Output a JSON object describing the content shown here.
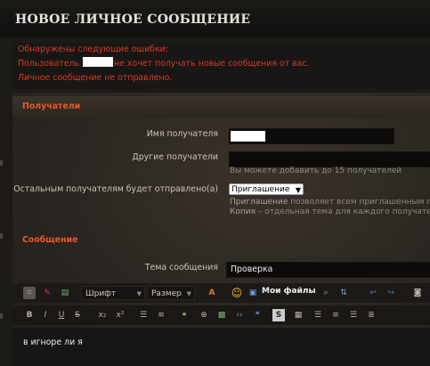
{
  "header": {
    "title": "НОВОЕ ЛИЧНОЕ СООБЩЕНИЕ"
  },
  "errors": {
    "line1": "Обнаружены следующие ошибки:",
    "line2_prefix": "Пользователь",
    "line2_suffix": "не хочет получать новые сообщения от вас.",
    "line3": "Личное сообщение не отправлено."
  },
  "recipients": {
    "heading": "Получатели",
    "recipient_name_label": "Имя получателя",
    "other_recipients_label": "Другие получатели",
    "other_recipients_hint": "Вы можете добавить до 15 получателей",
    "send_mode_label": "Остальным получателям будет отправлено(a)",
    "send_mode_value": "Приглашение",
    "hint_invite_term": "Приглашение",
    "hint_invite_text": "позволяет всем приглашенным п",
    "hint_copy_term": "Копия",
    "hint_copy_text": "– отдельная тема для каждого получате"
  },
  "message": {
    "heading": "Сообщение",
    "subject_label": "Тема сообщения",
    "subject_value": "Проверка",
    "body_text": "в игноре ли я"
  },
  "toolbar": {
    "font_label": "Шрифт",
    "size_label": "Размер",
    "my_files_label": "Мои файлы"
  }
}
